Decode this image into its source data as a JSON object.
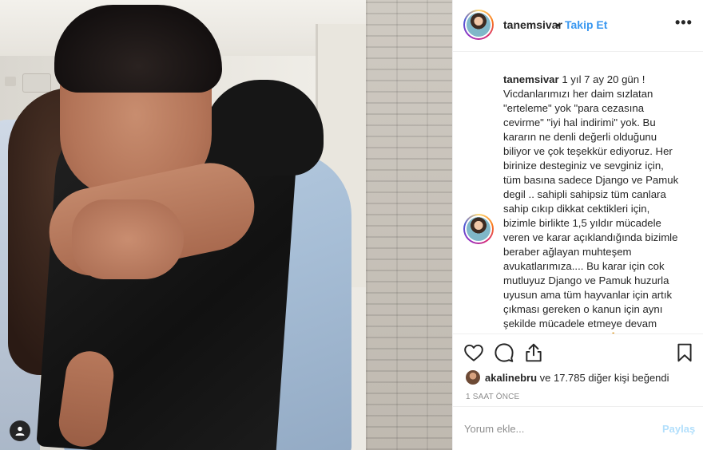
{
  "post": {
    "username": "tanemsivar",
    "separator": "•",
    "follow_label": "Takip Et",
    "more_label": "•••",
    "caption_text": "1 yıl 7 ay 20 gün ! Vicdanlarımızı her daim sızlatan \"erteleme\" yok \"para cezasına cevirme\" \"iyi hal indirimi\" yok. Bu kararın ne denli değerli olduğunu biliyor ve çok teşekkür ediyoruz. Her birinize desteginiz ve sevginiz için, tüm basına sadece Django ve Pamuk degil .. sahipli sahipsiz tüm canlara sahip cıkıp dikkat cektikleri için, bizimle birlikte 1,5 yıldır mücadele veren ve karar açıklandığında bizimle beraber ağlayan muhteşem avukatlarımıza.... Bu karar için cok mutluyuz Django ve Pamuk huzurla uyusun ama tüm hayvanlar için artık çıkması gereken o kanun için aynı şekilde mücadele etmeye devam edeceğiz! Hep birlikte 🙏 Artık hayvanlara zarar vermeden önce",
    "likes_user": "akalinebru",
    "likes_rest": " ve 17.785 diğer kişi beğendi",
    "time_ago": "1 SAAT ÖNCE",
    "comment_placeholder": "Yorum ekle...",
    "share_label": "Paylaş"
  },
  "icons": {
    "like": "heart-icon",
    "comment": "comment-icon",
    "share": "share-icon",
    "save": "bookmark-icon",
    "tagged": "user-tag-icon"
  },
  "colors": {
    "link_blue": "#3897f0",
    "share_disabled": "#b2dffc",
    "muted": "#8e8e8e",
    "text": "#262626"
  }
}
